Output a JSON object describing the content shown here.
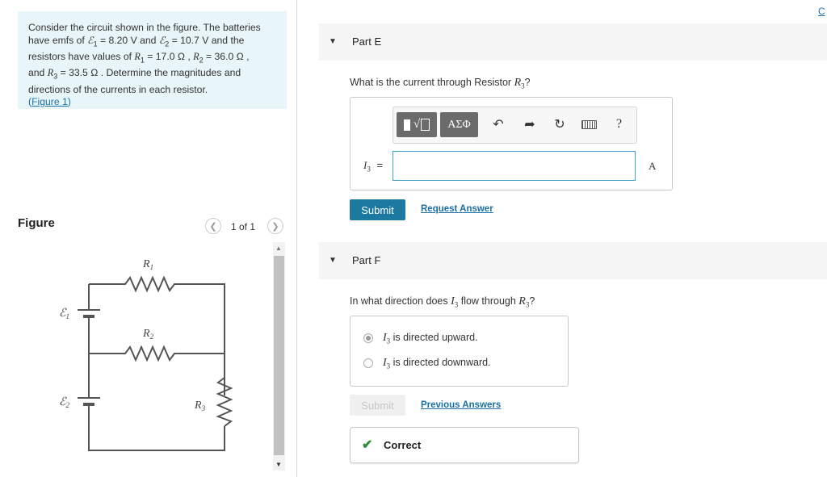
{
  "problem": {
    "line1": "Consider the circuit shown in the figure. The batteries",
    "line2_pre": "have emfs of ",
    "emf1_sym": "ℰ",
    "emf1_sub": "1",
    "emf1_val": " = 8.20 V",
    "and": " and ",
    "emf2_sym": "ℰ",
    "emf2_sub": "2",
    "emf2_val": " = 10.7 V and the",
    "line3_pre": "resistors have values of ",
    "r1": "R",
    "r1_sub": "1",
    "r1_val": " = 17.0 Ω , ",
    "r2": "R",
    "r2_sub": "2",
    "r2_val": " = 36.0 Ω ,",
    "line4_pre": "and ",
    "r3": "R",
    "r3_sub": "3",
    "r3_val": " = 33.5 Ω . Determine the magnitudes and",
    "line5": "directions of the currents in each resistor.",
    "figure_link": "Figure 1",
    "paren_open": "(",
    "paren_close": ")"
  },
  "figure_panel": {
    "title": "Figure",
    "page": "1 of 1",
    "prev_icon": "chevron-left-icon",
    "next_icon": "chevron-right-icon",
    "labels": {
      "R1": "R",
      "R1_sub": "1",
      "R2": "R",
      "R2_sub": "2",
      "R3": "R",
      "R3_sub": "3",
      "E1": "ℰ",
      "E1_sub": "1",
      "E2": "ℰ",
      "E2_sub": "2"
    }
  },
  "top_right_link": "C",
  "part_e": {
    "label": "Part E",
    "question_pre": "What is the current through Resistor ",
    "question_var": "R",
    "question_sub": "3",
    "question_post": "?",
    "toolbar": {
      "templates_label": "√",
      "greek_label": "ΑΣΦ",
      "undo_icon": "undo-icon",
      "redo_icon": "redo-icon",
      "reset_icon": "reset-icon",
      "keyboard_icon": "keyboard-icon",
      "help_label": "?"
    },
    "input_var": "I",
    "input_sub": "3",
    "equals": "=",
    "input_value": "",
    "unit": "A",
    "submit": "Submit",
    "request_answer": "Request Answer"
  },
  "part_f": {
    "label": "Part F",
    "question_pre": "In what direction does ",
    "question_var1": "I",
    "question_sub1": "3",
    "question_mid": " flow through ",
    "question_var2": "R",
    "question_sub2": "3",
    "question_post": "?",
    "choices": [
      {
        "var": "I",
        "sub": "3",
        "text": " is directed upward.",
        "selected": true
      },
      {
        "var": "I",
        "sub": "3",
        "text": " is directed downward.",
        "selected": false
      }
    ],
    "submit": "Submit",
    "previous_answers": "Previous Answers",
    "status": "Correct",
    "status_color": "#2e8b3a"
  }
}
